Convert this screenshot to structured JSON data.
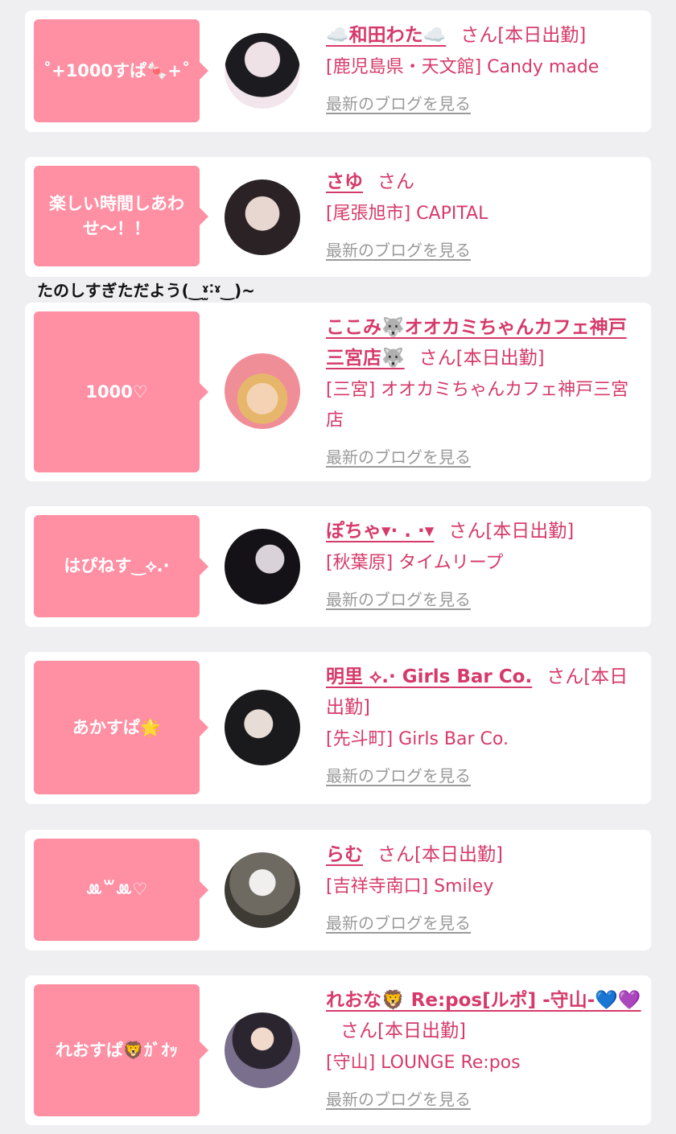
{
  "caption": "たのしすぎただよう(‿ˠ̫˸ˠ‿)~",
  "san": "さん",
  "blog_label": "最新のブログを見る",
  "entries": [
    {
      "bubble": "˚+1000すぱ🍬+˚",
      "name": "☁️和田わた☁️",
      "status": "[本日出勤]",
      "shop": "[鹿児島県・天文館] Candy made"
    },
    {
      "bubble": "楽しい時間しあわせ〜！！",
      "name": "さゆ",
      "status": "",
      "shop": "[尾張旭市] CAPITAL"
    },
    {
      "bubble": "1000♡",
      "name": "ここみ🐺オオカミちゃんカフェ神戸三宮店🐺",
      "status": "[本日出勤]",
      "shop": "[三宮] オオカミちゃんカフェ神戸三宮店"
    },
    {
      "bubble": "はぴねす‿⟡.·",
      "name": "ぽちゃ▾· . ·▾",
      "status": "[本日出勤]",
      "shop": "[秋葉原] タイムリープ"
    },
    {
      "bubble": "あかすぱ🌟",
      "name": "明里 ⟡.· Girls Bar Co.",
      "status": "[本日出勤]",
      "shop": "[先斗町] Girls Bar Co."
    },
    {
      "bubble": "ꔛ꒳ꔛ♡",
      "name": "らむ",
      "status": "[本日出勤]",
      "shop": "[吉祥寺南口] Smiley"
    },
    {
      "bubble": "れおすぱ🦁ｶﾞｵｯ",
      "name": "れおな🦁 Re:pos[ルポ] -守山-💙💜",
      "status": "[本日出勤]",
      "shop": "[守山] LOUNGE Re:pos"
    }
  ],
  "colors": {
    "accent": "#d63a6a",
    "bubble": "#ff8fa3",
    "muted": "#9a9a9a"
  }
}
